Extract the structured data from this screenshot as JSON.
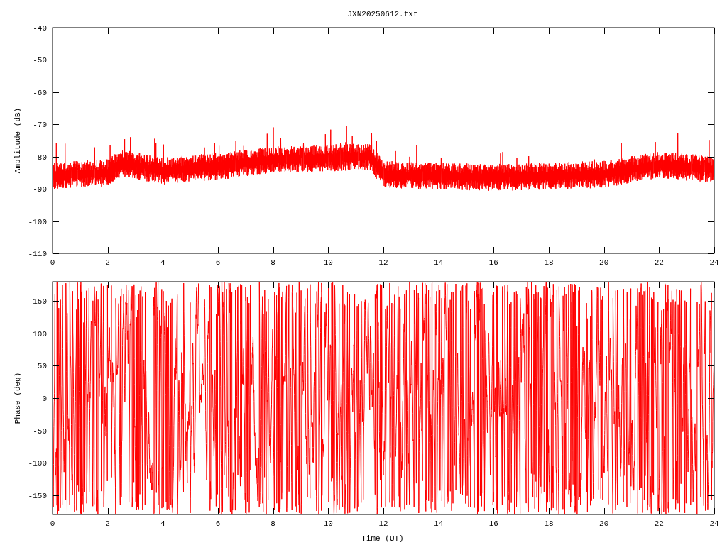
{
  "title": "JXN20250612.txt",
  "plots": [
    {
      "kind": "amplitude",
      "ylabel": "Amplitude (dB)",
      "yticks": [
        "-40",
        "-50",
        "-60",
        "-70",
        "-80",
        "-90",
        "-100",
        "-110"
      ],
      "xticks": [
        "0",
        "2",
        "4",
        "6",
        "8",
        "10",
        "12",
        "14",
        "16",
        "18",
        "20",
        "22",
        "24"
      ]
    },
    {
      "kind": "phase",
      "ylabel": "Phase (deg)",
      "yticks": [
        "150",
        "100",
        "50",
        "0",
        "-50",
        "-100",
        "-150"
      ],
      "xticks": [
        "0",
        "2",
        "4",
        "6",
        "8",
        "10",
        "12",
        "14",
        "16",
        "18",
        "20",
        "22",
        "24"
      ],
      "xlabel": "Time (UT)"
    }
  ]
}
